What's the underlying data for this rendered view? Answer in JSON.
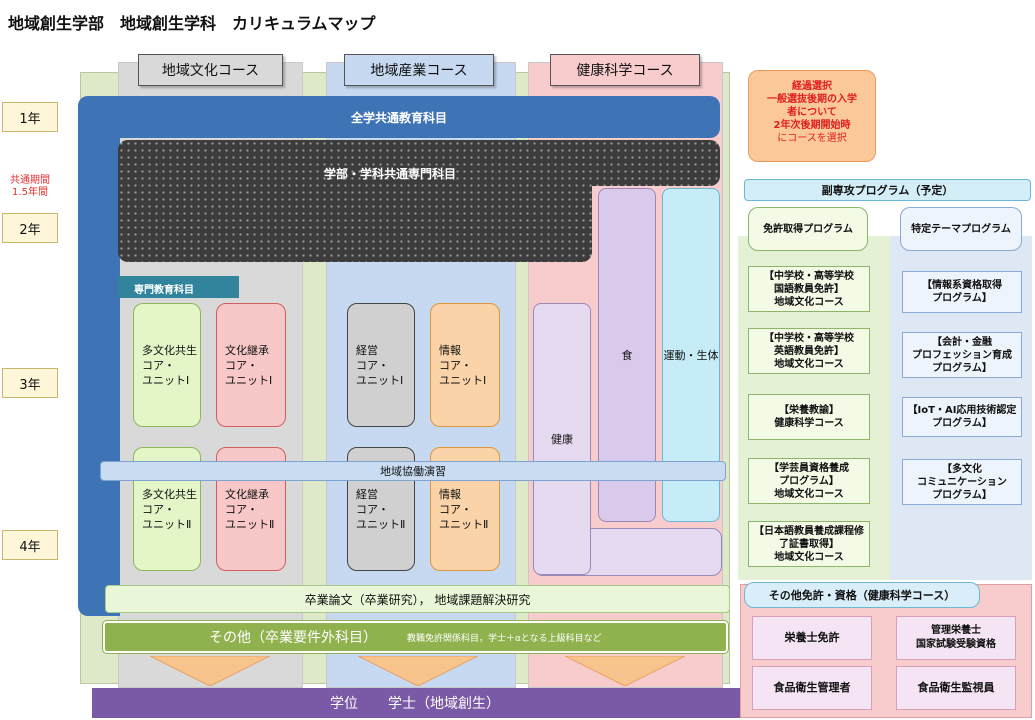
{
  "title": "地域創生学部　地域創生学科　カリキュラムマップ",
  "years": [
    "1年",
    "2年",
    "3年",
    "4年"
  ],
  "common_period_note": "共通期間\n1.5年間",
  "courses": {
    "culture": "地域文化コース",
    "industry": "地域産業コース",
    "health": "健康科学コース"
  },
  "selection_note": {
    "main": "経過選択\n一般選抜後期の入学\n者について\n2年次後期開始時",
    "sub": "にコースを選択"
  },
  "general_education": "全学共通教育科目",
  "faculty_common": "学部・学科共通専門科目",
  "specialized_label": "専門教育科目",
  "units": {
    "multicultural_1": "多文化共生\nコア・\nユニットⅠ",
    "heritage_1": "文化継承\nコア・\nユニットⅠ",
    "management_1": "経営\nコア・\nユニットⅠ",
    "information_1": "情報\nコア・\nユニットⅠ",
    "multicultural_2": "多文化共生\nコア・\nユニットⅡ",
    "heritage_2": "文化継承\nコア・\nユニットⅡ",
    "management_2": "経営\nコア・\nユニットⅡ",
    "information_2": "情報\nコア・\nユニットⅡ"
  },
  "health_columns": {
    "health": "健康",
    "food": "食",
    "sports": "運動・生体"
  },
  "regional_practice": "地域協働演習",
  "graduation": "卒業論文（卒業研究）， 地域課題解決研究",
  "other": {
    "main": "その他（卒業要件外科目）",
    "detail": "教職免許関係科目，学士＋αとなる上級科目など"
  },
  "degree": {
    "label": "学位",
    "value": "学士（地域創生）"
  },
  "minor": {
    "title": "副専攻プログラム（予定）",
    "license_header": "免許取得プログラム",
    "theme_header": "特定テーマプログラム",
    "license_items": [
      "【中学校・高等学校\n国語教員免許】\n地域文化コース",
      "【中学校・高等学校\n英語教員免許】\n地域文化コース",
      "【栄養教諭】\n健康科学コース",
      "【学芸員資格養成\nプログラム】\n地域文化コース",
      "【日本語教員養成課程修\n了証書取得】\n地域文化コース"
    ],
    "theme_items": [
      "【情報系資格取得\nプログラム】",
      "【会計・金融\nプロフェッション育成\nプログラム】",
      "【IoT・AI応用技術認定\nプログラム】",
      "【多文化\nコミュニケーション\nプログラム】"
    ]
  },
  "other_licenses": {
    "title": "その他免許・資格（健康科学コース）",
    "items": [
      "栄養士免許",
      "管理栄養士\n国家試験受験資格",
      "食品衛生管理者",
      "食品衛生監視員"
    ]
  }
}
